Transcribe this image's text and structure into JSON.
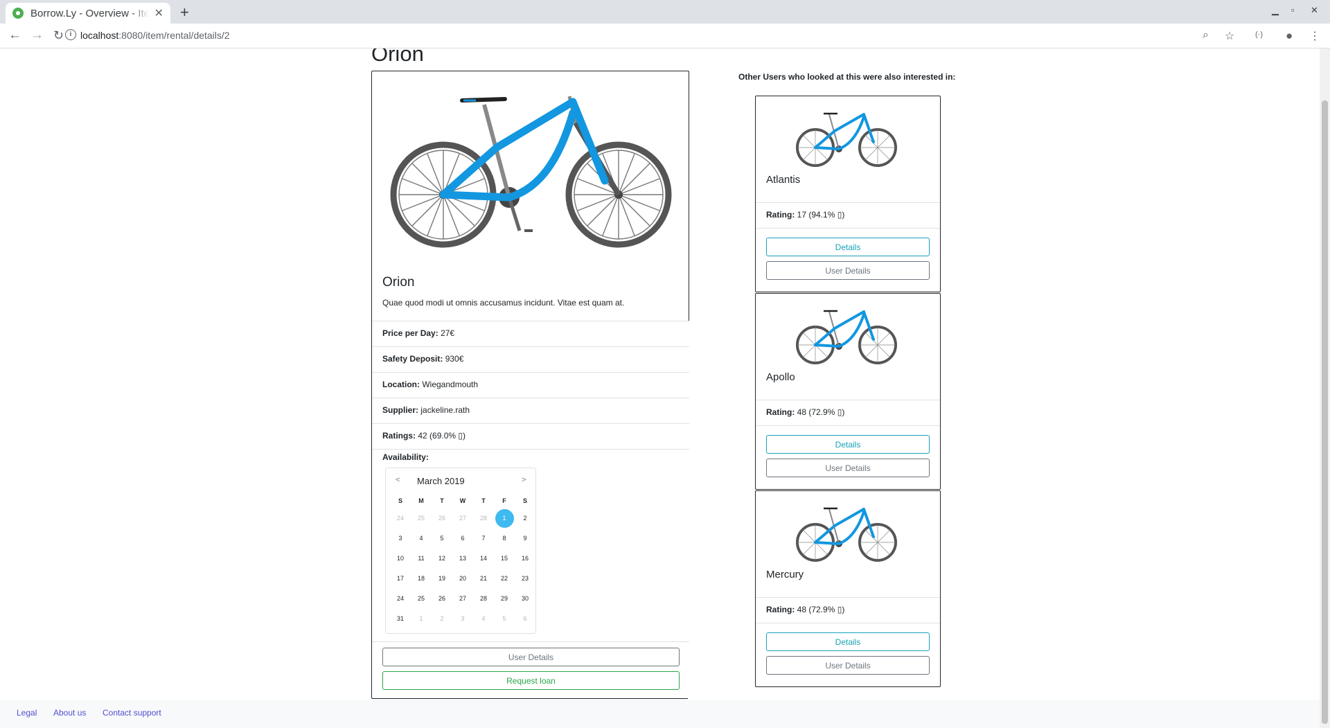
{
  "browser": {
    "tab_title": "Borrow.Ly - Overview - Item Details",
    "url_host": "localhost",
    "url_rest": ":8080/item/rental/details/2"
  },
  "item": {
    "title": "Orion",
    "name": "Orion",
    "description": "Quae quod modi ut omnis accusamus incidunt. Vitae est quam at.",
    "properties": [
      {
        "label": "Price per Day:",
        "value": "27€"
      },
      {
        "label": "Safety Deposit:",
        "value": "930€"
      },
      {
        "label": "Location:",
        "value": "Wiegandmouth"
      },
      {
        "label": "Supplier:",
        "value": "jackeline.rath"
      },
      {
        "label": "Ratings:",
        "value": "42 (69.0% ▯)"
      }
    ],
    "availability_label": "Availability:",
    "user_details_label": "User Details",
    "request_loan_label": "Request loan"
  },
  "calendar": {
    "month": "March 2019",
    "prev": "<",
    "next": ">",
    "weekdays": [
      "S",
      "M",
      "T",
      "W",
      "T",
      "F",
      "S"
    ],
    "days": [
      [
        "24",
        "25",
        "26",
        "27",
        "28",
        "1",
        "2"
      ],
      [
        "3",
        "4",
        "5",
        "6",
        "7",
        "8",
        "9"
      ],
      [
        "10",
        "11",
        "12",
        "13",
        "14",
        "15",
        "16"
      ],
      [
        "17",
        "18",
        "19",
        "20",
        "21",
        "22",
        "23"
      ],
      [
        "24",
        "25",
        "26",
        "27",
        "28",
        "29",
        "30"
      ],
      [
        "31",
        "1",
        "2",
        "3",
        "4",
        "5",
        "6"
      ]
    ],
    "selected_day": "1"
  },
  "recommendations": {
    "heading": "Other Users who looked at this were also interested in:",
    "rating_label": "Rating:",
    "details_label": "Details",
    "user_details_label": "User Details",
    "items": [
      {
        "name": "Atlantis",
        "rating": "17 (94.1% ▯)"
      },
      {
        "name": "Apollo",
        "rating": "48 (72.9% ▯)"
      },
      {
        "name": "Mercury",
        "rating": "48 (72.9% ▯)"
      }
    ]
  },
  "footer": {
    "legal": "Legal",
    "about": "About us",
    "contact": "Contact support"
  },
  "colors": {
    "bike_frame": "#1297e0",
    "tire": "#555555",
    "accent_teal": "#17a2b8",
    "accent_green": "#28a745",
    "calendar_selected": "#3ebaf0"
  }
}
